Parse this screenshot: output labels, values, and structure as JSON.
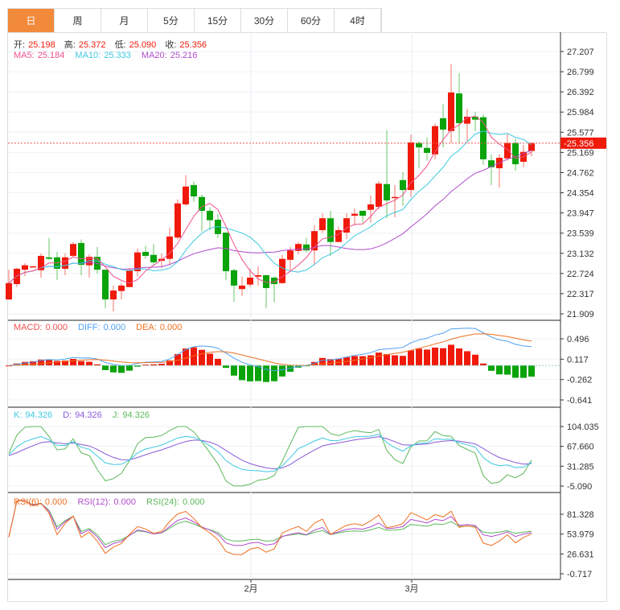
{
  "tabs": [
    {
      "label": "日",
      "active": true
    },
    {
      "label": "周"
    },
    {
      "label": "月"
    },
    {
      "label": "5分"
    },
    {
      "label": "15分"
    },
    {
      "label": "30分"
    },
    {
      "label": "60分"
    },
    {
      "label": "4时"
    }
  ],
  "ohlc_header": {
    "open_label": "开:",
    "open": "25.198",
    "high_label": "高:",
    "high": "25.372",
    "low_label": "低:",
    "low": "25.090",
    "close_label": "收:",
    "close": "25.356"
  },
  "ma_header": {
    "ma5_label": "MA5:",
    "ma5": "25.184",
    "ma10_label": "MA10:",
    "ma10": "25.333",
    "ma20_label": "MA20:",
    "ma20": "25.216"
  },
  "macd_header": {
    "macd_label": "MACD:",
    "macd": "0.000",
    "diff_label": "DIFF:",
    "diff": "0.000",
    "dea_label": "DEA:",
    "dea": "0.000"
  },
  "kdj_header": {
    "k_label": "K:",
    "k": "94.326",
    "d_label": "D:",
    "d": "94.326",
    "j_label": "J:",
    "j": "94.326"
  },
  "rsi_header": {
    "rsi6_label": "RSI(6):",
    "rsi6": "0.000",
    "rsi12_label": "RSI(12):",
    "rsi12": "0.000",
    "rsi24_label": "RSI(24):",
    "rsi24": "0.000"
  },
  "colors": {
    "up": "#f01a0a",
    "down": "#0aa30a",
    "ma5": "#f0508c",
    "ma10": "#3dc8e0",
    "ma20": "#b04ccc",
    "diff": "#4fa0f0",
    "dea": "#f07020",
    "k": "#3dc8e0",
    "d": "#8a5ad8",
    "j": "#5cb85c",
    "rsi6": "#f07020",
    "rsi12": "#b04ccc",
    "rsi24": "#5cb85c"
  },
  "chart_data": {
    "type": "candlestick",
    "last_price": "25.356",
    "price_axis": {
      "ticks": [
        "27.207",
        "26.799",
        "26.392",
        "25.984",
        "25.577",
        "25.169",
        "24.762",
        "24.354",
        "23.947",
        "23.539",
        "23.132",
        "22.724",
        "22.317",
        "21.909"
      ],
      "range": [
        21.909,
        27.207
      ]
    },
    "macd_axis": {
      "ticks": [
        "0.496",
        "0.117",
        "-0.262",
        "-0.641"
      ],
      "range": [
        -0.641,
        0.496
      ]
    },
    "kdj_axis": {
      "ticks": [
        "104.035",
        "67.660",
        "31.285",
        "-5.090"
      ],
      "range": [
        -5.09,
        104.035
      ]
    },
    "rsi_axis": {
      "ticks": [
        "81.328",
        "53.979",
        "26.631",
        "-0.717"
      ],
      "range": [
        -0.717,
        81.328
      ]
    },
    "x_labels": [
      {
        "label": "2月",
        "index": 30
      },
      {
        "label": "3月",
        "index": 50
      }
    ],
    "candles": [
      [
        22.2,
        22.8,
        22.19,
        22.53
      ],
      [
        22.51,
        22.84,
        22.45,
        22.82
      ],
      [
        22.8,
        22.93,
        22.67,
        22.89
      ],
      [
        22.85,
        22.87,
        22.85,
        22.87
      ],
      [
        22.79,
        23.13,
        22.64,
        23.08
      ],
      [
        23.05,
        23.44,
        23.0,
        23.02
      ],
      [
        23.05,
        23.16,
        22.59,
        22.82
      ],
      [
        22.82,
        23.13,
        22.69,
        23.05
      ],
      [
        23.08,
        23.36,
        23.05,
        23.32
      ],
      [
        23.34,
        23.41,
        22.69,
        22.9
      ],
      [
        22.89,
        23.11,
        22.64,
        23.06
      ],
      [
        23.06,
        23.26,
        22.72,
        22.8
      ],
      [
        22.8,
        22.8,
        22.02,
        22.2
      ],
      [
        22.2,
        22.48,
        21.96,
        22.38
      ],
      [
        22.37,
        22.53,
        22.2,
        22.48
      ],
      [
        22.45,
        22.84,
        22.45,
        22.79
      ],
      [
        22.77,
        23.23,
        22.66,
        23.15
      ],
      [
        23.16,
        23.28,
        23.02,
        23.08
      ],
      [
        23.1,
        23.32,
        22.89,
        22.95
      ],
      [
        22.98,
        23.13,
        22.84,
        23.02
      ],
      [
        23.02,
        23.65,
        22.89,
        23.47
      ],
      [
        23.45,
        24.22,
        23.41,
        24.14
      ],
      [
        24.12,
        24.71,
        24.09,
        24.48
      ],
      [
        24.51,
        24.58,
        24.17,
        24.28
      ],
      [
        24.27,
        24.32,
        23.57,
        23.99
      ],
      [
        23.99,
        24.06,
        23.6,
        23.8
      ],
      [
        23.81,
        23.93,
        23.44,
        23.52
      ],
      [
        23.55,
        23.55,
        22.59,
        22.77
      ],
      [
        22.79,
        22.82,
        22.15,
        22.48
      ],
      [
        22.41,
        22.66,
        22.27,
        22.48
      ],
      [
        22.5,
        22.82,
        22.45,
        22.64
      ],
      [
        22.66,
        22.87,
        22.48,
        22.69
      ],
      [
        22.69,
        22.69,
        22.02,
        22.43
      ],
      [
        22.64,
        22.67,
        22.14,
        22.51
      ],
      [
        22.53,
        23.1,
        22.51,
        23.02
      ],
      [
        23.0,
        23.26,
        22.79,
        23.19
      ],
      [
        23.18,
        23.36,
        23.11,
        23.32
      ],
      [
        23.31,
        23.44,
        23.15,
        23.19
      ],
      [
        23.19,
        23.7,
        22.89,
        23.58
      ],
      [
        23.6,
        23.94,
        23.54,
        23.84
      ],
      [
        23.84,
        23.99,
        23.08,
        23.36
      ],
      [
        23.36,
        23.67,
        23.36,
        23.6
      ],
      [
        23.55,
        23.94,
        23.42,
        23.84
      ],
      [
        23.89,
        24.04,
        23.7,
        23.93
      ],
      [
        23.99,
        23.99,
        23.75,
        23.89
      ],
      [
        24.01,
        24.3,
        23.75,
        24.12
      ],
      [
        24.07,
        24.59,
        24.02,
        24.54
      ],
      [
        24.53,
        25.62,
        23.84,
        24.2
      ],
      [
        24.25,
        24.51,
        23.86,
        24.27
      ],
      [
        24.61,
        24.77,
        24.09,
        24.41
      ],
      [
        24.41,
        25.53,
        24.27,
        25.37
      ],
      [
        25.36,
        25.39,
        24.85,
        25.27
      ],
      [
        25.26,
        25.47,
        25.0,
        25.16
      ],
      [
        25.13,
        25.75,
        25.03,
        25.7
      ],
      [
        25.86,
        26.14,
        25.27,
        25.63
      ],
      [
        25.6,
        26.95,
        25.36,
        26.38
      ],
      [
        26.36,
        26.77,
        25.36,
        25.76
      ],
      [
        25.75,
        26.05,
        25.36,
        25.89
      ],
      [
        25.89,
        25.99,
        25.6,
        25.83
      ],
      [
        25.88,
        25.94,
        24.92,
        25.03
      ],
      [
        25.01,
        25.13,
        24.51,
        24.87
      ],
      [
        24.85,
        25.13,
        24.46,
        25.06
      ],
      [
        25.05,
        25.55,
        25.0,
        25.36
      ],
      [
        25.36,
        25.45,
        24.8,
        24.93
      ],
      [
        24.98,
        25.32,
        24.87,
        25.18
      ],
      [
        25.198,
        25.372,
        25.09,
        25.356
      ]
    ]
  }
}
